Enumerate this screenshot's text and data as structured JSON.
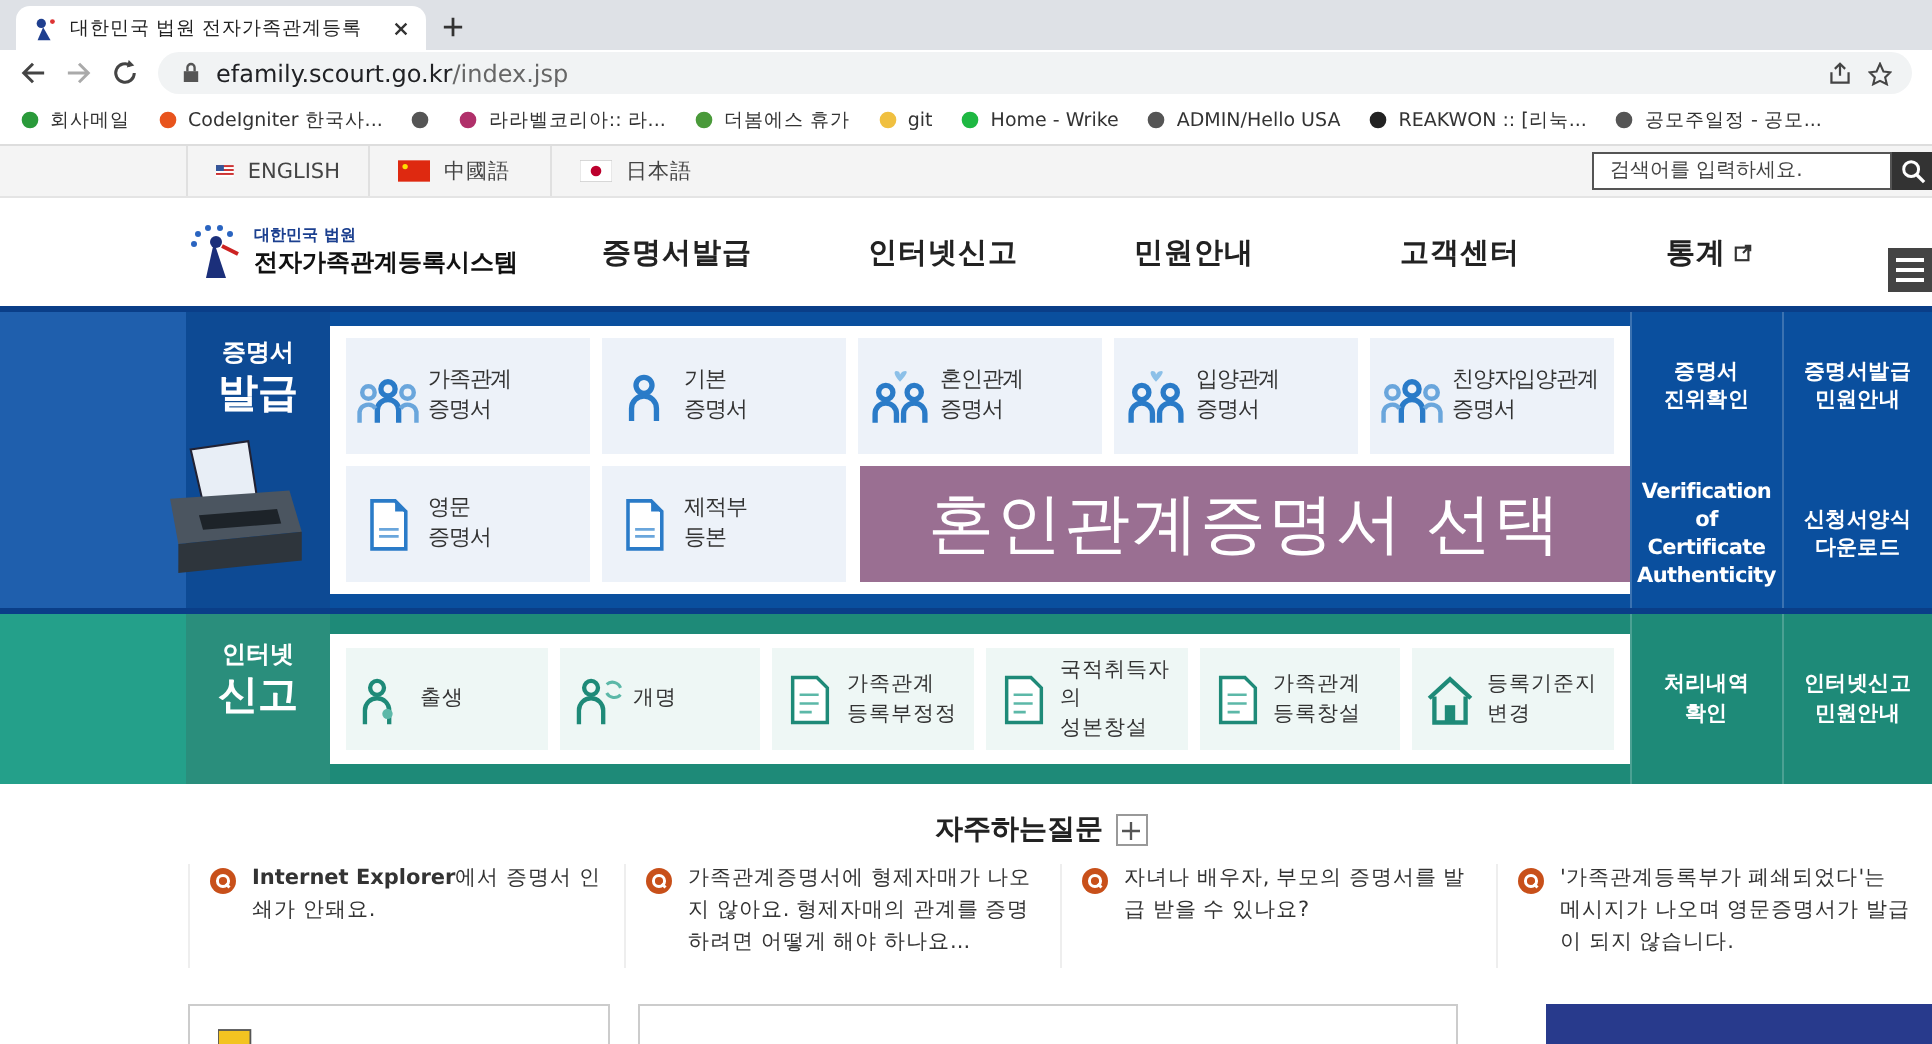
{
  "browser": {
    "tab_title": "대한민국 법원 전자가족관계등록",
    "url_host": "efamily.scourt.go.kr",
    "url_path": "/index.jsp",
    "bookmarks": [
      {
        "kind": "link",
        "label": "회사메일"
      },
      {
        "kind": "link",
        "label": "CodeIgniter 한국사..."
      },
      {
        "kind": "icon"
      },
      {
        "kind": "link",
        "label": "라라벨코리아:: 라..."
      },
      {
        "kind": "link",
        "label": "더봄에스 휴가"
      },
      {
        "kind": "link",
        "label": "git"
      },
      {
        "kind": "link",
        "label": "Home - Wrike"
      },
      {
        "kind": "link",
        "label": "ADMIN/Hello USA"
      },
      {
        "kind": "link",
        "label": "REAKWON :: [리눅..."
      },
      {
        "kind": "link",
        "label": "공모주일정 - 공모..."
      }
    ]
  },
  "language_bar": {
    "languages": [
      "ENGLISH",
      "中國語",
      "日本語"
    ],
    "search": {
      "placeholder": "검색어를 입력하세요."
    }
  },
  "header": {
    "logo_small": "대한민국 법원",
    "logo_title": "전자가족관계등록시스템",
    "nav": [
      {
        "label": "증명서발급",
        "external": false
      },
      {
        "label": "인터넷신고",
        "external": false
      },
      {
        "label": "민원안내",
        "external": false
      },
      {
        "label": "고객센터",
        "external": false
      },
      {
        "label": "통계",
        "external": true
      }
    ]
  },
  "certificate_section": {
    "title_small": "증명서",
    "title_large": "발급",
    "tiles": [
      {
        "lines": [
          "가족관계",
          "증명서"
        ]
      },
      {
        "lines": [
          "기본",
          "증명서"
        ]
      },
      {
        "lines": [
          "혼인관계",
          "증명서"
        ]
      },
      {
        "lines": [
          "입양관계",
          "증명서"
        ]
      },
      {
        "lines": [
          "친양자입양관계",
          "증명서"
        ]
      },
      {
        "lines": [
          "영문",
          "증명서"
        ]
      },
      {
        "lines": [
          "제적부",
          "등본"
        ]
      }
    ],
    "links": [
      {
        "lines": [
          "증명서",
          "진위확인"
        ]
      },
      {
        "lines": [
          "증명서발급",
          "민원안내"
        ]
      },
      {
        "lines": [
          "Verification of",
          "Certificate",
          "Authenticity"
        ]
      },
      {
        "lines": [
          "신청서양식",
          "다운로드"
        ]
      }
    ]
  },
  "report_section": {
    "title_small": "인터넷",
    "title_large": "신고",
    "tiles": [
      {
        "lines": [
          "출생"
        ]
      },
      {
        "lines": [
          "개명"
        ]
      },
      {
        "lines": [
          "가족관계",
          "등록부정정"
        ]
      },
      {
        "lines": [
          "국적취득자의",
          "성본창설"
        ]
      },
      {
        "lines": [
          "가족관계",
          "등록창설"
        ]
      },
      {
        "lines": [
          "등록기준지",
          "변경"
        ]
      }
    ],
    "links": [
      {
        "lines": [
          "처리내역",
          "확인"
        ]
      },
      {
        "lines": [
          "인터넷신고",
          "민원안내"
        ]
      }
    ]
  },
  "caption_overlay": "혼인관계증명서 선택",
  "faq": {
    "title": "자주하는질문",
    "items": [
      "**Internet Explorer**에서 증명서 인쇄가 안돼요.",
      "가족관계증명서에 형제자매가 나오지 않아요. 형제자매의 관계를 증명하려면 어떻게 해야 하나요...",
      "자녀나 배우자, 부모의 증명서를 발급 받을 수 있나요?",
      "'가족관계등록부가 폐쇄되었다'는 메시지가 나오며 영문증명서가 발급이 되지 않습니다."
    ]
  }
}
